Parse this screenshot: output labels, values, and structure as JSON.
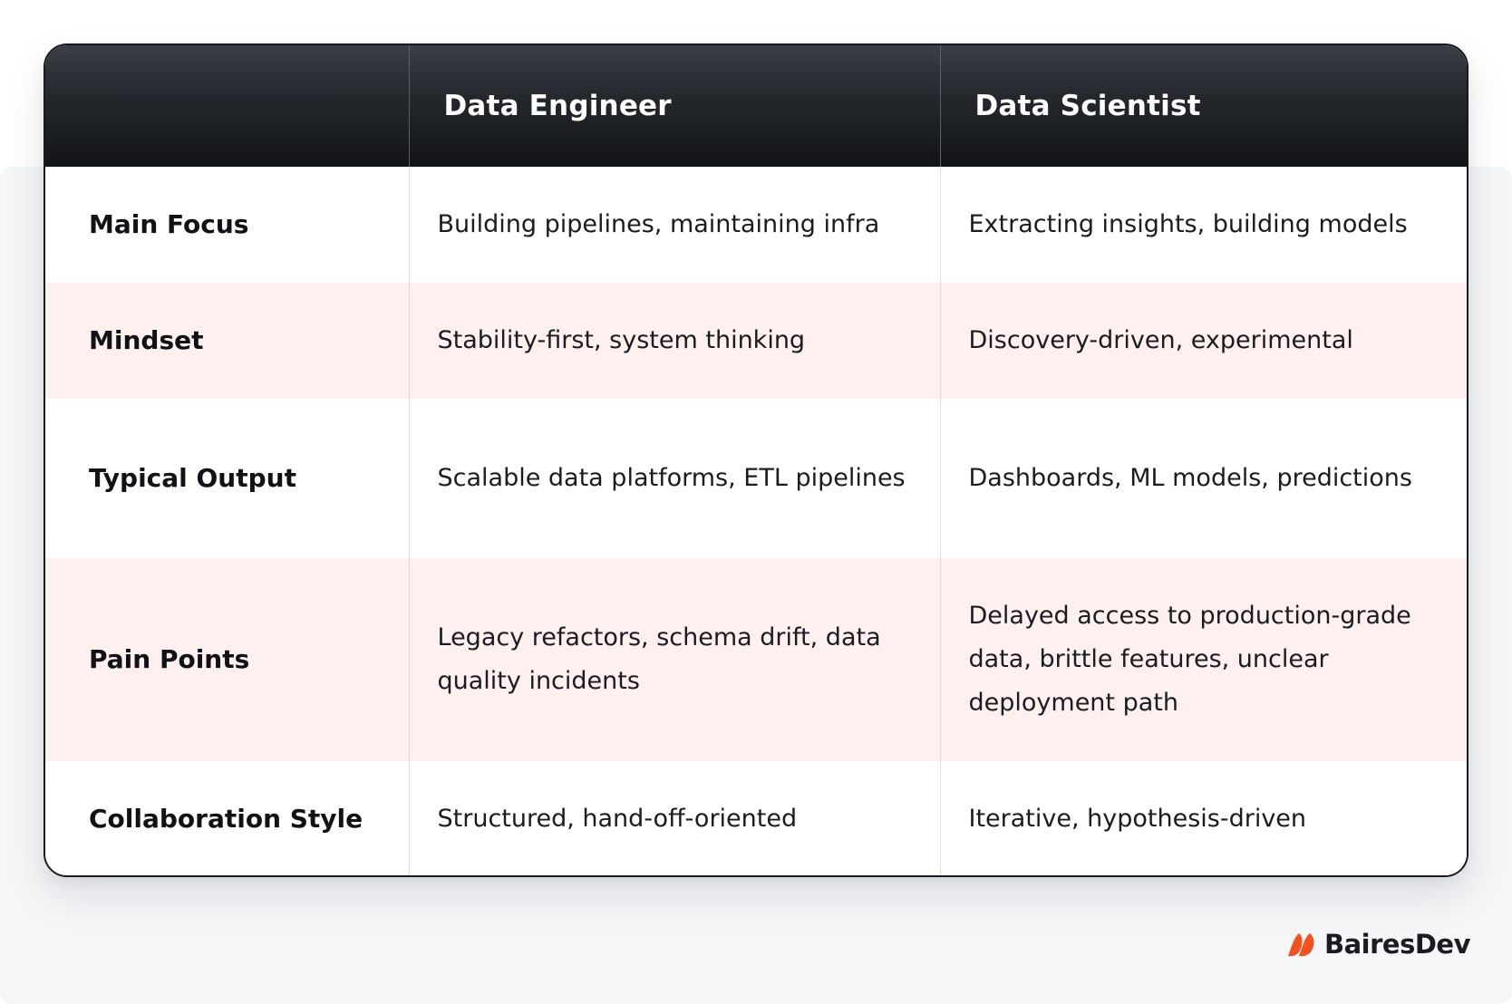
{
  "table": {
    "columns": [
      "",
      "Data Engineer",
      "Data Scientist"
    ],
    "rows": [
      {
        "label": "Main Focus",
        "engineer": "Building pipelines, maintaining infra",
        "scientist": "Extracting insights, building models"
      },
      {
        "label": "Mindset",
        "engineer": "Stability-first, system thinking",
        "scientist": "Discovery-driven, experimental"
      },
      {
        "label": "Typical Output",
        "engineer": "Scalable data platforms, ETL pipelines",
        "scientist": "Dashboards, ML models, predictions"
      },
      {
        "label": "Pain Points",
        "engineer": "Legacy refactors, schema drift, data quality incidents",
        "scientist": "Delayed access to production-grade data, brittle features, unclear deployment path"
      },
      {
        "label": "Collaboration Style",
        "engineer": "Structured, hand-off-oriented",
        "scientist": "Iterative, hypothesis-driven"
      }
    ]
  },
  "brand": {
    "name": "BairesDev",
    "icon": "bairesdev-logo-icon",
    "accent_color": "#f4511e"
  },
  "colors": {
    "header_bg": "#1a1d21",
    "row_alt_bg": "#fdf0ee",
    "page_bg": "#f5f6f8"
  }
}
